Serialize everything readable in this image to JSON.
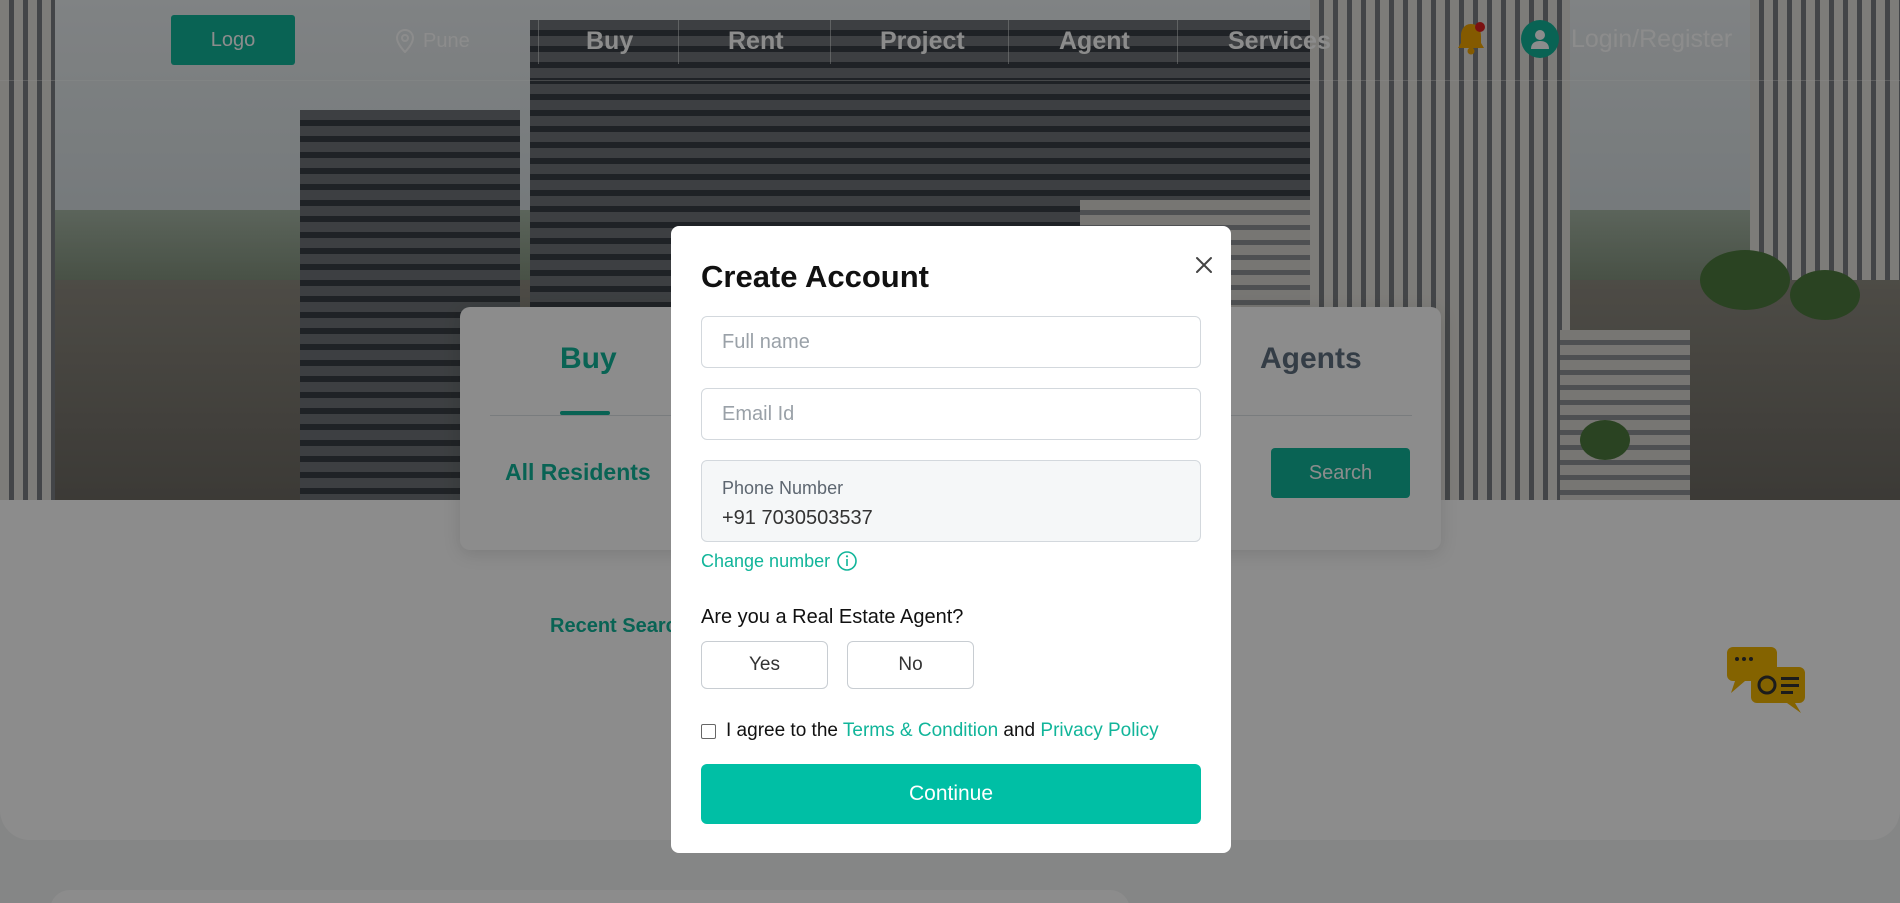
{
  "header": {
    "logo_label": "Logo",
    "location": "Pune",
    "nav": [
      "Buy",
      "Rent",
      "Project",
      "Agent",
      "Services"
    ],
    "login_label": "Login/Register"
  },
  "search": {
    "tab_buy": "Buy",
    "tab_agents": "Agents",
    "category": "All Residents",
    "search_label": "Search",
    "recent_label": "Recent Searc"
  },
  "modal": {
    "title": "Create Account",
    "full_name_placeholder": "Full name",
    "email_placeholder": "Email Id",
    "phone_label": "Phone Number",
    "phone_value": "+91 7030503537",
    "change_number": "Change number",
    "question": "Are you a Real Estate Agent?",
    "yes_label": "Yes",
    "no_label": "No",
    "agree_prefix": "I agree to the",
    "terms_link": "Terms & Condition",
    "and_text": "and",
    "privacy_link": "Privacy Policy",
    "continue_label": "Continue"
  },
  "colors": {
    "accent": "#11b59a",
    "continue": "#00bfa5"
  },
  "icons": {
    "location": "location-pin-icon",
    "bell": "notification-bell-icon",
    "user": "user-icon",
    "close": "close-icon",
    "info": "info-icon",
    "chat": "chat-support-icon"
  }
}
